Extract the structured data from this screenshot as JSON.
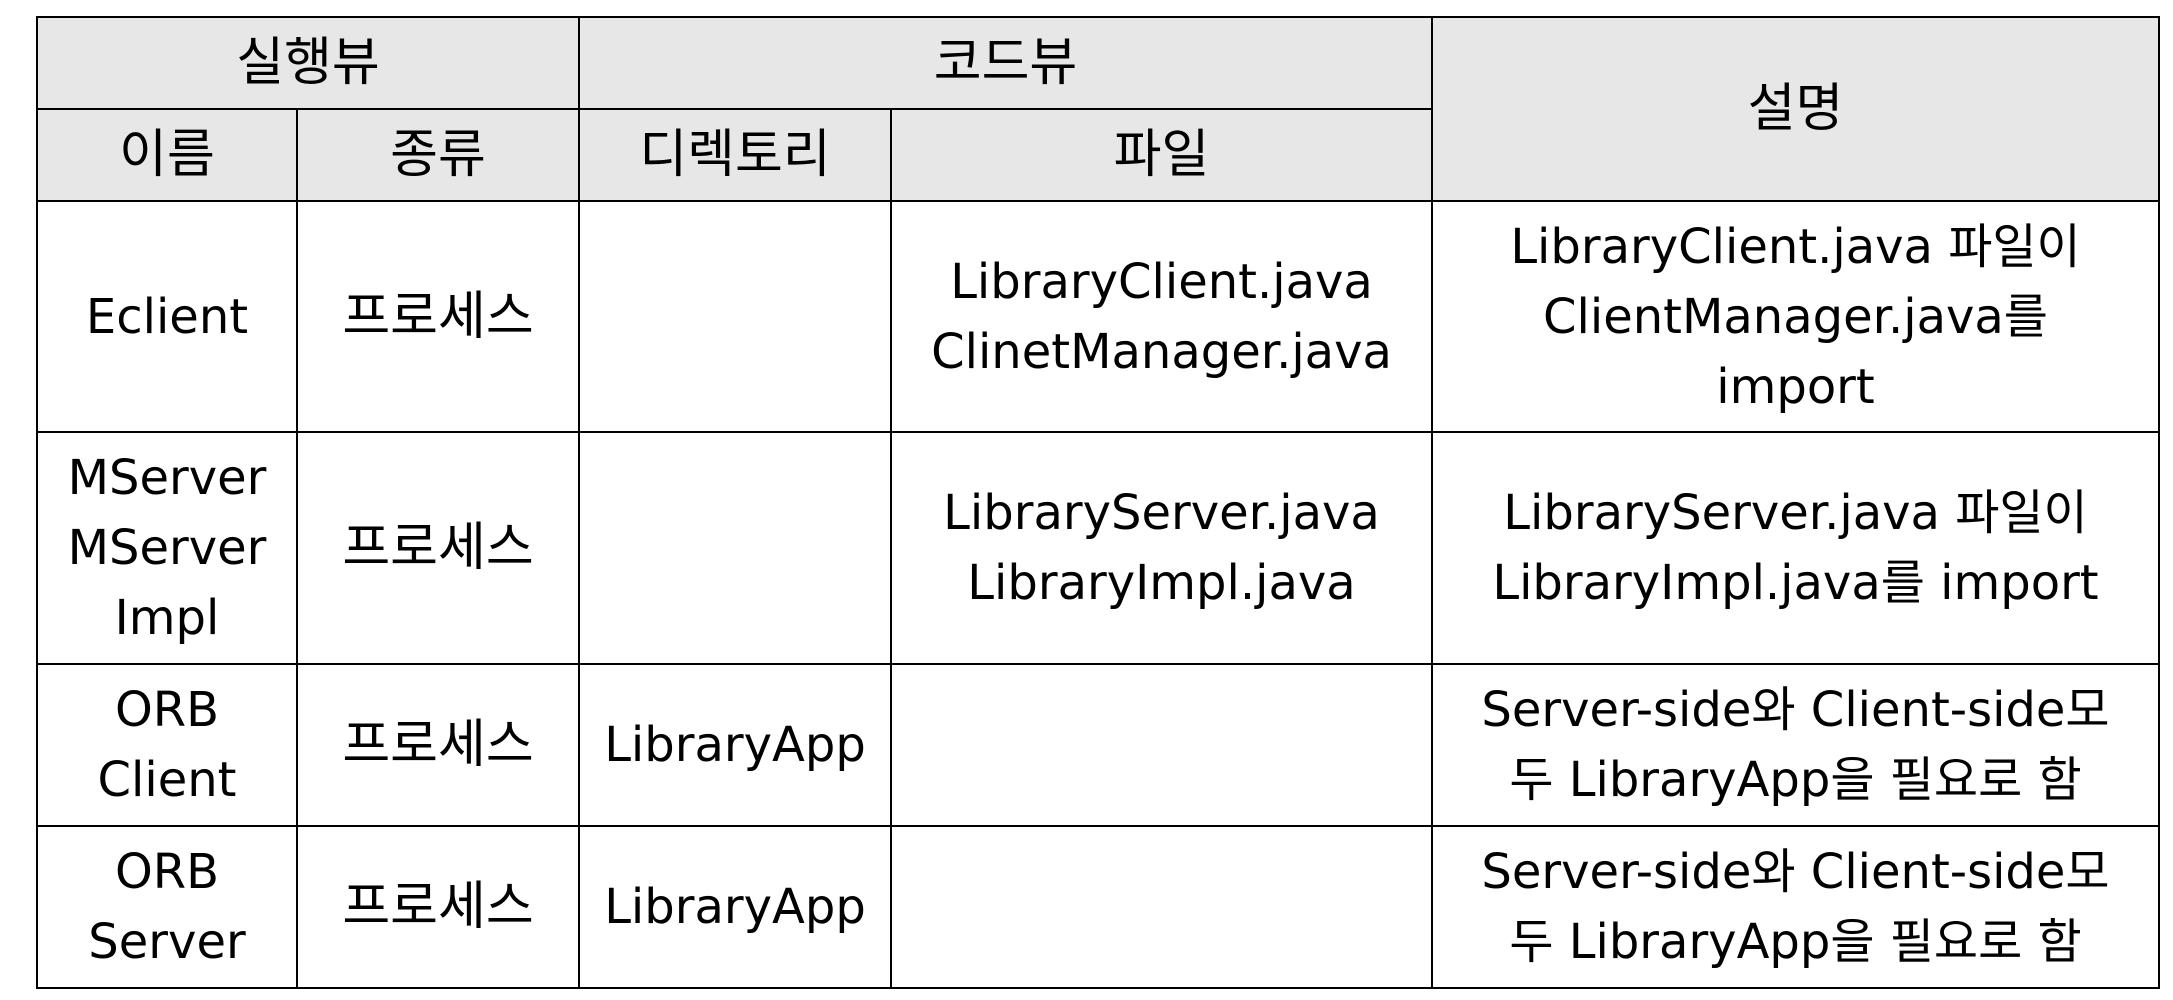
{
  "header": {
    "group_runtime_view": "실행뷰",
    "group_code_view": "코드뷰",
    "col_description": "설명",
    "col_name": "이름",
    "col_kind": "종류",
    "col_directory": "디렉토리",
    "col_file": "파일"
  },
  "rows": [
    {
      "name": [
        "Eclient"
      ],
      "kind": "프로세스",
      "directory": "",
      "files": [
        "LibraryClient.java",
        "ClinetManager.java"
      ],
      "description": [
        "LibraryClient.java 파일이",
        "ClientManager.java를",
        "import"
      ]
    },
    {
      "name": [
        "MServer",
        "MServer",
        "Impl"
      ],
      "kind": "프로세스",
      "directory": "",
      "files": [
        "LibraryServer.java",
        "LibraryImpl.java"
      ],
      "description": [
        "LibraryServer.java 파일이",
        "LibraryImpl.java를 import"
      ]
    },
    {
      "name": [
        "ORB",
        "Client"
      ],
      "kind": "프로세스",
      "directory": "LibraryApp",
      "files": [],
      "description": [
        "Server-side와 Client-side모",
        "두 LibraryApp을 필요로 함"
      ]
    },
    {
      "name": [
        "ORB",
        "Server"
      ],
      "kind": "프로세스",
      "directory": "LibraryApp",
      "files": [],
      "description": [
        "Server-side와 Client-side모",
        "두 LibraryApp을 필요로 함"
      ]
    }
  ]
}
